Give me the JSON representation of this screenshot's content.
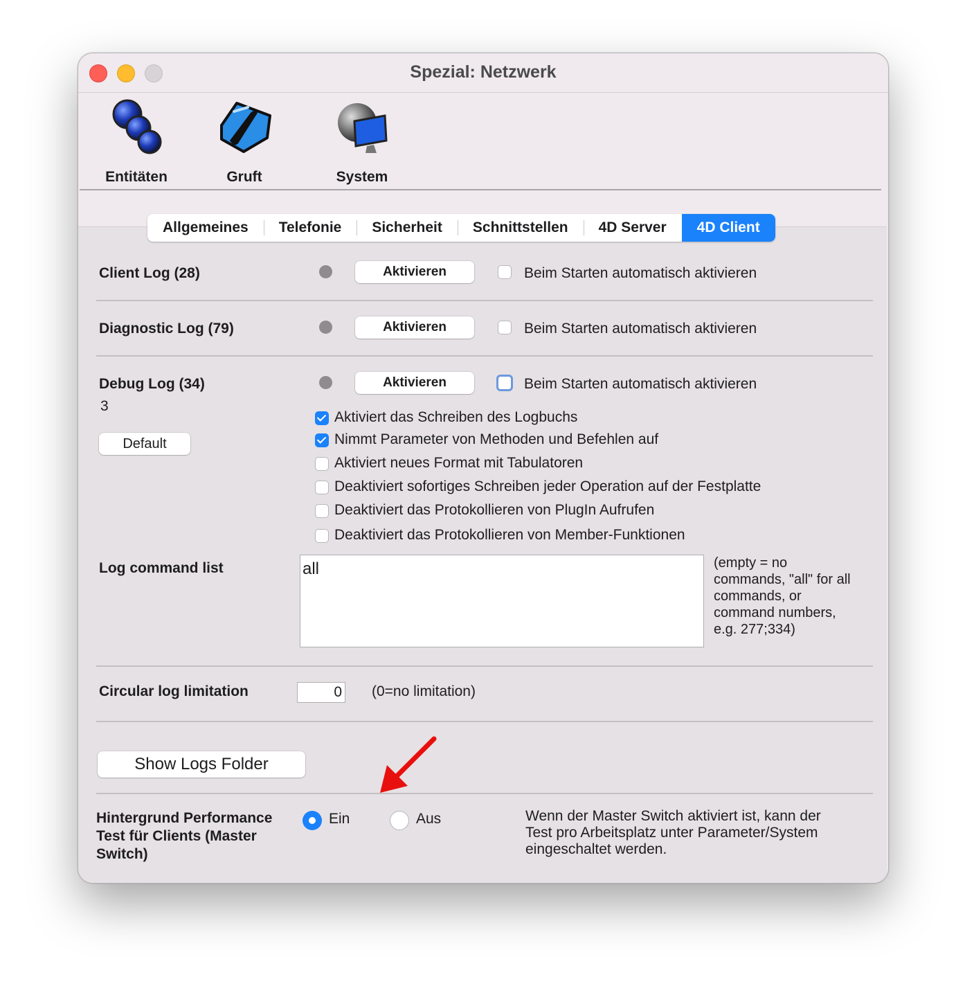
{
  "window": {
    "title": "Spezial: Netzwerk"
  },
  "toolbar": {
    "items": [
      {
        "label": "Entitäten",
        "icon": "entities-icon"
      },
      {
        "label": "Gruft",
        "icon": "crypt-icon"
      },
      {
        "label": "System",
        "icon": "system-icon"
      }
    ]
  },
  "tabs": [
    "Allgemeines",
    "Telefonie",
    "Sicherheit",
    "Schnittstellen",
    "4D Server",
    "4D Client"
  ],
  "active_tab": "4D Client",
  "logs": [
    {
      "label": "Client Log (28)",
      "button": "Aktivieren",
      "autostart": "Beim Starten automatisch aktivieren"
    },
    {
      "label": "Diagnostic Log (79)",
      "button": "Aktivieren",
      "autostart": "Beim Starten automatisch aktivieren"
    },
    {
      "label": "Debug Log (34)",
      "button": "Aktivieren",
      "autostart": "Beim Starten automatisch aktivieren",
      "level": "3",
      "default_button": "Default"
    }
  ],
  "debug_options": [
    {
      "label": "Aktiviert das Schreiben des Logbuchs",
      "checked": true
    },
    {
      "label": "Nimmt Parameter von Methoden und Befehlen auf",
      "checked": true
    },
    {
      "label": "Aktiviert neues Format mit Tabulatoren",
      "checked": false
    },
    {
      "label": "Deaktiviert sofortiges Schreiben jeder Operation auf der Festplatte",
      "checked": false
    },
    {
      "label": "Deaktiviert das Protokollieren von PlugIn Aufrufen",
      "checked": false
    },
    {
      "label": "Deaktiviert das Protokollieren von Member-Funktionen",
      "checked": false
    }
  ],
  "log_command_list": {
    "label": "Log command list",
    "value": "all",
    "hint": [
      "(empty = no",
      "commands, \"all\" for all",
      "commands, or",
      "command numbers,",
      "e.g. 277;334)"
    ]
  },
  "circular_log": {
    "label": "Circular log limitation",
    "value": "0",
    "hint": "(0=no limitation)"
  },
  "show_logs_button": "Show Logs Folder",
  "performance_test": {
    "label": [
      "Hintergrund Performance",
      "Test für Clients (Master",
      "Switch)"
    ],
    "option_on": "Ein",
    "option_off": "Aus",
    "selected": "Ein",
    "note": [
      "Wenn der Master Switch aktiviert ist, kann der",
      "Test pro Arbeitsplatz unter Parameter/System",
      "eingeschaltet werden."
    ]
  },
  "colors": {
    "accent": "#1a82fb",
    "annotation_arrow": "#e8100e"
  }
}
